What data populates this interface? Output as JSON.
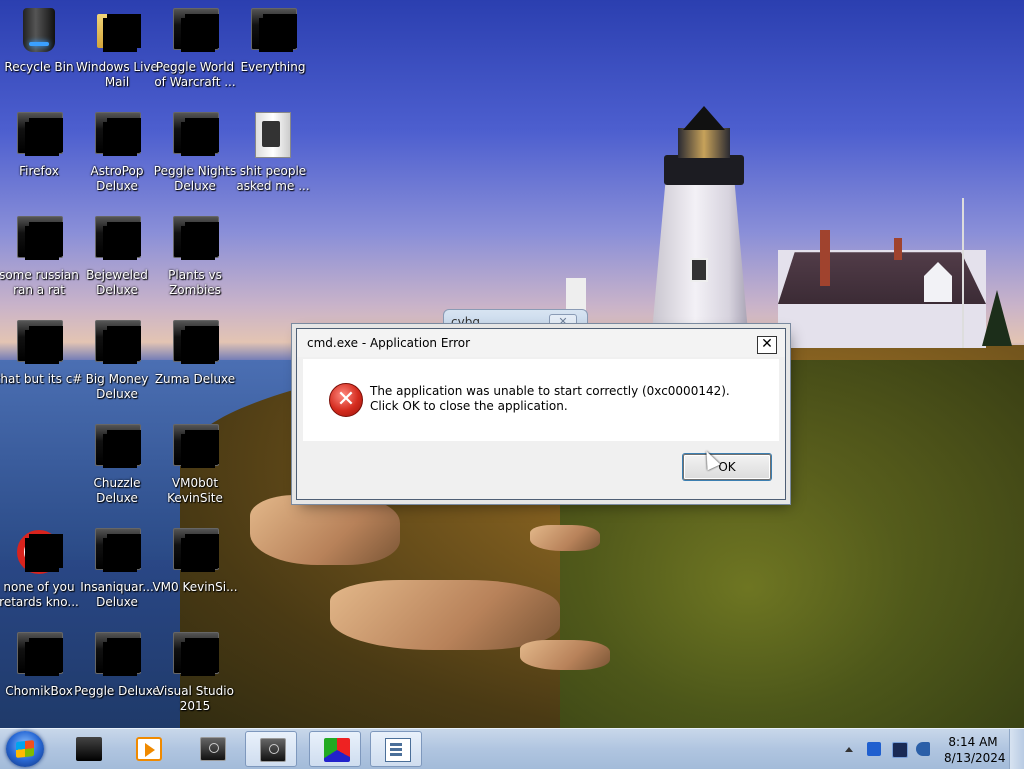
{
  "desktop": {
    "icons": [
      {
        "label": "Recycle Bin",
        "icon": "recycle-bin-icon"
      },
      {
        "label": "Windows Live Mail",
        "icon": "mail-folder-icon"
      },
      {
        "label": "Peggle World of Warcraft ...",
        "icon": "app-icon"
      },
      {
        "label": "Everything",
        "icon": "app-icon"
      },
      {
        "label": "Firefox",
        "icon": "app-icon"
      },
      {
        "label": "AstroPop Deluxe",
        "icon": "app-icon"
      },
      {
        "label": "Peggle Nights Deluxe",
        "icon": "app-icon"
      },
      {
        "label": "shit people asked me ...",
        "icon": "zip-archive-icon"
      },
      {
        "label": "some russian ran a rat",
        "icon": "app-icon"
      },
      {
        "label": "Bejeweled Deluxe",
        "icon": "app-icon"
      },
      {
        "label": "Plants vs Zombies",
        "icon": "app-icon"
      },
      {
        "label": "that but its c#",
        "icon": "app-icon"
      },
      {
        "label": "Big Money Deluxe",
        "icon": "app-icon"
      },
      {
        "label": "Zuma Deluxe",
        "icon": "app-icon"
      },
      {
        "label": "Chuzzle Deluxe",
        "icon": "app-icon"
      },
      {
        "label": "VM0b0t KevinSite",
        "icon": "app-icon"
      },
      {
        "label": "none of you retards kno...",
        "icon": "opera-icon"
      },
      {
        "label": "Insaniquar... Deluxe",
        "icon": "app-icon"
      },
      {
        "label": "VM0 KevinSi...",
        "icon": "app-icon"
      },
      {
        "label": "ChomikBox",
        "icon": "app-icon"
      },
      {
        "label": "Peggle Deluxe",
        "icon": "app-icon"
      },
      {
        "label": "Visual Studio 2015",
        "icon": "app-icon"
      }
    ]
  },
  "background_window": {
    "title": "cvbg",
    "close_glyph": "✕"
  },
  "dialog": {
    "title": "cmd.exe - Application Error",
    "close_glyph": "✕",
    "icon": "error-icon",
    "icon_glyph": "✕",
    "message": "The application was unable to start correctly (0xc0000142). Click OK to close the application.",
    "ok_label": "OK"
  },
  "taskbar": {
    "items": [
      {
        "icon": "monitor-icon",
        "active": false
      },
      {
        "icon": "media-player-icon",
        "active": false
      },
      {
        "icon": "clock-app-icon",
        "active": false
      },
      {
        "icon": "clock-app-icon",
        "active": true
      },
      {
        "icon": "3d-cube-icon",
        "active": true
      },
      {
        "icon": "window-app-icon",
        "active": true
      }
    ],
    "clock": {
      "time": "8:14 AM",
      "date": "8/13/2024"
    },
    "tray_icons": [
      "show-hidden-icons-icon",
      "bluetooth-icon",
      "network-icon",
      "volume-icon"
    ]
  }
}
